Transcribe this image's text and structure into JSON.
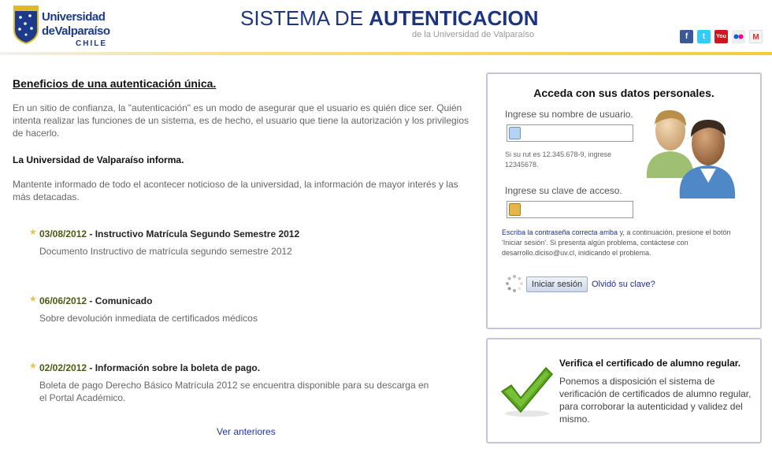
{
  "header": {
    "logo_line1": "Universidad",
    "logo_line2": "deValparaíso",
    "logo_line3": "CHILE",
    "title_light": "SISTEMA DE ",
    "title_bold": "AUTENTICACION",
    "subtitle": "de la Universidad de Valparaíso",
    "social_icons": [
      "facebook-icon",
      "twitter-icon",
      "youtube-icon",
      "flickr-icon",
      "gmail-icon"
    ]
  },
  "left": {
    "heading": "Beneficios de una autenticación única.",
    "intro": "En un sitio de confianza, la \"autenticación\" es un modo de asegurar que el usuario es quién dice ser. Quién intenta realizar las funciones de un sistema, es de hecho, el usuario que tiene la autorización y los privilegios de hacerlo.",
    "inform_title": "La Universidad de Valparaíso informa.",
    "inform_text": "Mantente informado de todo el acontecer noticioso de la universidad, la información de mayor interés y las más detacadas.",
    "news": [
      {
        "date": "03/08/2012",
        "title": " - Instructivo Matrícula Segundo Semestre 2012",
        "desc": "Documento Instructivo de matrícula segundo semestre 2012"
      },
      {
        "date": "06/06/2012",
        "title": " - Comunicado",
        "desc": "Sobre devolución inmediata de certificados médicos"
      },
      {
        "date": "02/02/2012",
        "title": " - Información sobre la boleta de pago.",
        "desc": "Boleta de pago Derecho Básico Matrícula 2012 se encuentra disponible para su descarga en el Portal Académico."
      }
    ],
    "more_link": "Ver anteriores"
  },
  "login": {
    "title": "Acceda con sus datos personales.",
    "username_label": "Ingrese su nombre de usuario.",
    "username_value": "",
    "hint": "Si su rut es 12.345.678-9, ingrese 12345678.",
    "password_label": "Ingrese su clave de acceso.",
    "password_value": "",
    "instr_link": "Escriba la contraseña correcta arriba",
    "instr_rest": " y, a continuación, presione el botón 'Iniciar sesión'. Si presenta algún problema, contáctese con desarrollo.diciso@uv.cl, inidicando el problema.",
    "button": "Iniciar sesión",
    "forgot": "Olvidó su clave?"
  },
  "verify": {
    "title": "Verifica el certificado de alumno regular.",
    "text": "Ponemos a disposición el sistema de verificación de certificados de alumno regular, para corroborar la autenticidad y validez del mismo."
  },
  "colors": {
    "brand_blue": "#1d3480",
    "link_blue": "#1c2ea0",
    "accent_yellow": "#f4cc3a",
    "check_green": "#5aa51d",
    "date_olive": "#4a5a12"
  }
}
